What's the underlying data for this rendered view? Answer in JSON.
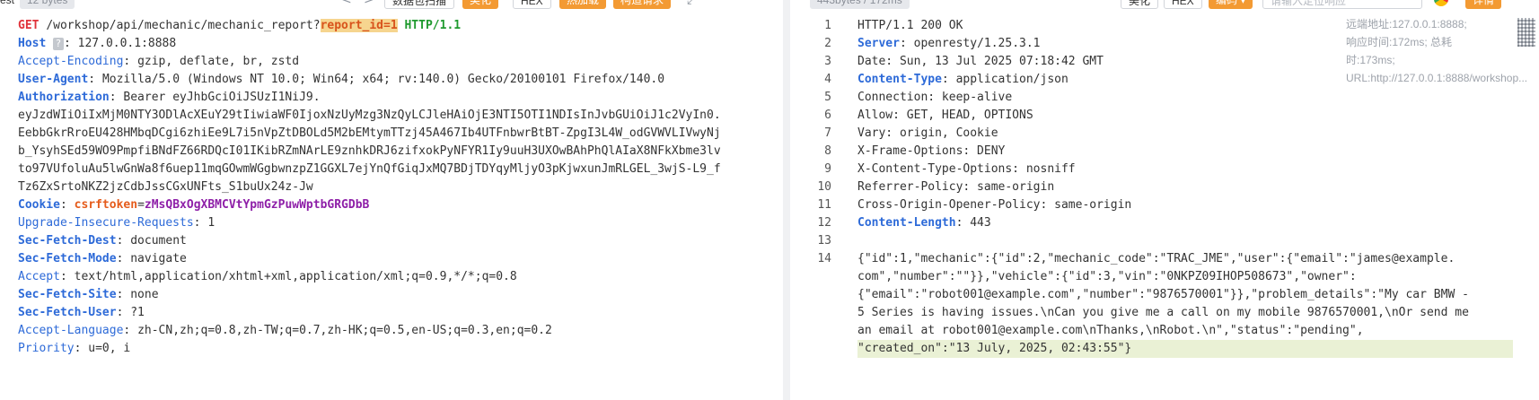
{
  "request_toolbar": {
    "label_fragment": "est",
    "size": "12 bytes",
    "back_glyph": "<",
    "forward_glyph": ">",
    "scan_label": "数据包扫描",
    "pretty_label": "美化",
    "hex_label": "HEX",
    "hotload_label": "热加载",
    "construct_label": "构造请求",
    "expand_glyph": "⤢"
  },
  "request": {
    "method": "GET",
    "path": "/workshop/api/mechanic/mechanic_report?",
    "param": "report_id=1",
    "protocol": "HTTP/1.1",
    "host_key": "Host",
    "host_badge": "?",
    "host_val": "127.0.0.1:8888",
    "accept_encoding_key": "Accept-Encoding",
    "accept_encoding_val": "gzip, deflate, br, zstd",
    "user_agent_key": "User-Agent",
    "user_agent_val": "Mozilla/5.0 (Windows NT 10.0; Win64; x64; rv:140.0) Gecko/20100101 Firefox/140.0",
    "authorization_key": "Authorization",
    "authorization_val": "Bearer eyJhbGciOiJSUzI1NiJ9.",
    "token_lines": [
      "eyJzdWIiOiIxMjM0NTY3ODlAcXEuY29tIiwiaWF0IjoxNzUyMzg3NzQyLCJleHAiOjE3NTI5OTI1NDIsInJvbGUiOiJ1c2VyIn0.",
      "EebbGkrRroEU428HMbqDCgi6zhiEe9L7i5nVpZtDBOLd5M2bEMtymTTzj45A467Ib4UTFnbwrBtBT-ZpgI3L4W_odGVWVLIVwyNj",
      "b_YsyhSEd59WO9PmpfiBNdFZ66RDQcI01IKibRZmNArLE9znhkDRJ6zifxokPyNFYR1Iy9uuH3UXOwBAhPhQlAIaX8NFkXbme3lv",
      "to97VUfoluAu5lwGnWa8f6uep11mqGOwmWGgbwnzpZ1GGXL7ejYnQfGiqJxMQ7BDjTDYqyMljyO3pKjwxunJmRLGEL_3wjS-L9_f",
      "Tz6ZxSrtoNKZ2jzCdbJssCGxUNFts_S1buUx24z-Jw"
    ],
    "cookie_key": "Cookie",
    "csrf_key": "csrftoken",
    "csrf_val": "zMsQBxOgXBMCVtYpmGzPuwWptbGRGDbB",
    "upgrade_key": "Upgrade-Insecure-Requests",
    "upgrade_val": "1",
    "sfd_key": "Sec-Fetch-Dest",
    "sfd_val": "document",
    "sfm_key": "Sec-Fetch-Mode",
    "sfm_val": "navigate",
    "accept_key": "Accept",
    "accept_val": "text/html,application/xhtml+xml,application/xml;q=0.9,*/*;q=0.8",
    "sfs_key": "Sec-Fetch-Site",
    "sfs_val": "none",
    "sfu_key": "Sec-Fetch-User",
    "sfu_val": "?1",
    "accept_lang_key": "Accept-Language",
    "accept_lang_val": "zh-CN,zh;q=0.8,zh-TW;q=0.7,zh-HK;q=0.5,en-US;q=0.3,en;q=0.2",
    "priority_key": "Priority",
    "priority_val": "u=0, i"
  },
  "response_toolbar": {
    "size": "443bytes / 172ms",
    "pretty_label": "美化",
    "hex_label": "HEX",
    "encode_label": "编码",
    "search_placeholder": "请输入定位响应",
    "detail_label": "详情"
  },
  "response": {
    "line_numbers": [
      "1",
      "2",
      "3",
      "4",
      "5",
      "6",
      "7",
      "8",
      "9",
      "10",
      "11",
      "12",
      "13",
      "14"
    ],
    "status_line": "HTTP/1.1 200 OK",
    "server_key": "Server",
    "server_val": "openresty/1.25.3.1",
    "date_line": "Date: Sun, 13 Jul 2025 07:18:42 GMT",
    "content_type_key": "Content-Type",
    "content_type_val": "application/json",
    "connection_line": "Connection: keep-alive",
    "allow_line": "Allow: GET, HEAD, OPTIONS",
    "vary_line": "Vary: origin, Cookie",
    "xfo_line": "X-Frame-Options: DENY",
    "xcto_line": "X-Content-Type-Options: nosniff",
    "referrer_line": "Referrer-Policy: same-origin",
    "coop_line": "Cross-Origin-Opener-Policy: same-origin",
    "content_length_key": "Content-Length",
    "content_length_val": "443",
    "body_lines": [
      "{\"id\":1,\"mechanic\":{\"id\":2,\"mechanic_code\":\"TRAC_JME\",\"user\":{\"email\":\"james@example.",
      "com\",\"number\":\"\"}},\"vehicle\":{\"id\":3,\"vin\":\"0NKPZ09IHOP508673\",\"owner\":",
      "{\"email\":\"robot001@example.com\",\"number\":\"9876570001\"}},\"problem_details\":\"My car BMW -",
      "5 Series is having issues.\\nCan you give me a call on my mobile 9876570001,\\nOr send me",
      "an email at robot001@example.com\\nThanks,\\nRobot.\\n\",\"status\":\"pending\","
    ],
    "body_last_line": "\"created_on\":\"13 July, 2025, 02:43:55\"}"
  },
  "side_info": {
    "text": "远端地址:127.0.0.1:8888; 响应时间:172ms; 总耗时:173ms; URL:http://127.0.0.1:8888/workshop..."
  }
}
